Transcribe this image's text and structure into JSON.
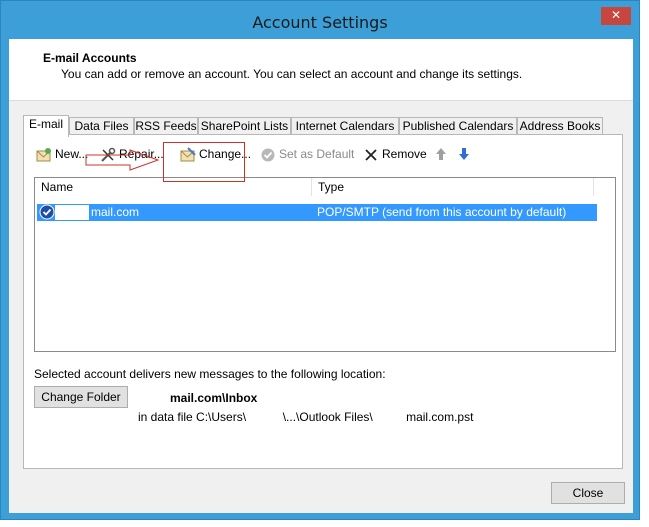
{
  "window": {
    "title": "Account Settings",
    "close_glyph": "✕"
  },
  "header": {
    "title": "E-mail Accounts",
    "subtitle": "You can add or remove an account. You can select an account and change its settings."
  },
  "tabs": [
    "E-mail",
    "Data Files",
    "RSS Feeds",
    "SharePoint Lists",
    "Internet Calendars",
    "Published Calendars",
    "Address Books"
  ],
  "toolbar": {
    "new": "New...",
    "repair": "Repair...",
    "change": "Change...",
    "set_default": "Set as Default",
    "remove": "Remove"
  },
  "list": {
    "columns": [
      "Name",
      "Type"
    ],
    "rows": [
      {
        "name": "mail.com",
        "type": "POP/SMTP (send from this account by default)"
      }
    ]
  },
  "location": {
    "label": "Selected account delivers new messages to the following location:",
    "change_folder": "Change Folder",
    "inbox_path": "mail.com\\Inbox",
    "data_file": "in data file C:\\Users\\           \\...\\Outlook Files\\          mail.com.pst"
  },
  "footer": {
    "close": "Close"
  },
  "colors": {
    "accent": "#3399ff",
    "frame": "#3c9fd7",
    "annotation": "#d0302c"
  }
}
